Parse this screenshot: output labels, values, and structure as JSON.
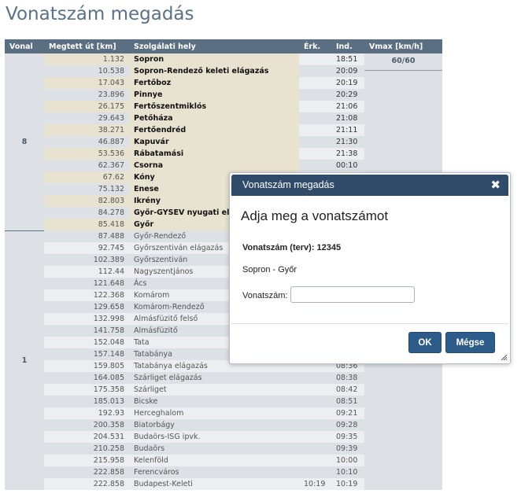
{
  "page": {
    "title": "Vonatszám megadás"
  },
  "table": {
    "headers": {
      "vonal": "Vonal",
      "km": "Megtett út [km]",
      "hely": "Szolgálati hely",
      "erk": "Érk.",
      "ind": "Ind.",
      "vmax": "Vmax [km/h]"
    },
    "vmax_value": "60/60",
    "groups": [
      {
        "vonal": "8",
        "rows": 15
      },
      {
        "vonal": "1",
        "rows": 24
      }
    ],
    "rows": [
      {
        "km": "1.132",
        "hely": "Sopron",
        "erk": "",
        "ind": "18:51",
        "hl": true
      },
      {
        "km": "10.538",
        "hely": "Sopron-Rendező keleti elágazás",
        "erk": "",
        "ind": "20:09",
        "hl": true
      },
      {
        "km": "17.043",
        "hely": "Fertőboz",
        "erk": "",
        "ind": "20:19",
        "hl": true
      },
      {
        "km": "23.896",
        "hely": "Pinnye",
        "erk": "",
        "ind": "20:29",
        "hl": true
      },
      {
        "km": "26.175",
        "hely": "Fertőszentmiklós",
        "erk": "",
        "ind": "21:06",
        "hl": true
      },
      {
        "km": "29.643",
        "hely": "Petőháza",
        "erk": "",
        "ind": "21:08",
        "hl": true
      },
      {
        "km": "38.271",
        "hely": "Fertőendréd",
        "erk": "",
        "ind": "21:11",
        "hl": true
      },
      {
        "km": "46.887",
        "hely": "Kapuvár",
        "erk": "",
        "ind": "21:30",
        "hl": true
      },
      {
        "km": "53.536",
        "hely": "Rábatamási",
        "erk": "",
        "ind": "21:38",
        "hl": true
      },
      {
        "km": "62.367",
        "hely": "Csorna",
        "erk": "",
        "ind": "00:10",
        "hl": true
      },
      {
        "km": "67.62",
        "hely": "Kóny",
        "erk": "",
        "ind": "",
        "hl": true
      },
      {
        "km": "75.132",
        "hely": "Enese",
        "erk": "",
        "ind": "",
        "hl": true
      },
      {
        "km": "82.803",
        "hely": "Ikrény",
        "erk": "",
        "ind": "",
        "hl": true
      },
      {
        "km": "84.278",
        "hely": "Győr-GYSEV nyugati elágazás",
        "erk": "",
        "ind": "",
        "hl": true
      },
      {
        "km": "85.418",
        "hely": "Győr",
        "erk": "",
        "ind": "",
        "hl": true
      },
      {
        "km": "87.488",
        "hely": "Győr-Rendező",
        "erk": "",
        "ind": "",
        "hl": false
      },
      {
        "km": "92.745",
        "hely": "Győrszentiván elágazás",
        "erk": "",
        "ind": "",
        "hl": false
      },
      {
        "km": "102.389",
        "hely": "Győrszentiván",
        "erk": "",
        "ind": "",
        "hl": false
      },
      {
        "km": "112.44",
        "hely": "Nagyszentjános",
        "erk": "",
        "ind": "",
        "hl": false
      },
      {
        "km": "121.648",
        "hely": "Ács",
        "erk": "",
        "ind": "",
        "hl": false
      },
      {
        "km": "122.368",
        "hely": "Komárom",
        "erk": "",
        "ind": "",
        "hl": false
      },
      {
        "km": "129.658",
        "hely": "Komárom-Rendező",
        "erk": "",
        "ind": "",
        "hl": false
      },
      {
        "km": "132.998",
        "hely": "Almásfüzitő felső",
        "erk": "",
        "ind": "",
        "hl": false
      },
      {
        "km": "141.758",
        "hely": "Almásfüzitő",
        "erk": "",
        "ind": "",
        "hl": false
      },
      {
        "km": "152.048",
        "hely": "Tata",
        "erk": "",
        "ind": "",
        "hl": false
      },
      {
        "km": "157.148",
        "hely": "Tatabánya",
        "erk": "",
        "ind": "",
        "hl": false
      },
      {
        "km": "159.805",
        "hely": "Tatabánya elágazás",
        "erk": "",
        "ind": "08:36",
        "hl": false
      },
      {
        "km": "164.085",
        "hely": "Szárliget elágazás",
        "erk": "",
        "ind": "08:38",
        "hl": false
      },
      {
        "km": "175.358",
        "hely": "Szárliget",
        "erk": "",
        "ind": "08:42",
        "hl": false
      },
      {
        "km": "185.013",
        "hely": "Bicske",
        "erk": "",
        "ind": "08:51",
        "hl": false
      },
      {
        "km": "192.93",
        "hely": "Herceghalom",
        "erk": "",
        "ind": "09:21",
        "hl": false
      },
      {
        "km": "200.358",
        "hely": "Biatorbágy",
        "erk": "",
        "ind": "09:28",
        "hl": false
      },
      {
        "km": "204.531",
        "hely": "Budaörs-ISG ipvk.",
        "erk": "",
        "ind": "09:35",
        "hl": false
      },
      {
        "km": "210.258",
        "hely": "Budaörs",
        "erk": "",
        "ind": "09:39",
        "hl": false
      },
      {
        "km": "215.958",
        "hely": "Kelenföld",
        "erk": "",
        "ind": "10:00",
        "hl": false
      },
      {
        "km": "222.858",
        "hely": "Ferencváros",
        "erk": "",
        "ind": "10:10",
        "hl": false
      },
      {
        "km": "222.858",
        "hely": "Budapest-Keleti",
        "erk": "10:19",
        "ind": "10:19",
        "hl": false
      }
    ]
  },
  "dialog": {
    "title": "Vonatszám megadás",
    "close_icon": "close-icon",
    "heading": "Adja meg a vonatszámot",
    "planned_label": "Vonatszám (terv): 12345",
    "route": "Sopron - Győr",
    "input_label": "Vonatszám:",
    "input_value": "",
    "ok_label": "OK",
    "cancel_label": "Mégse"
  }
}
